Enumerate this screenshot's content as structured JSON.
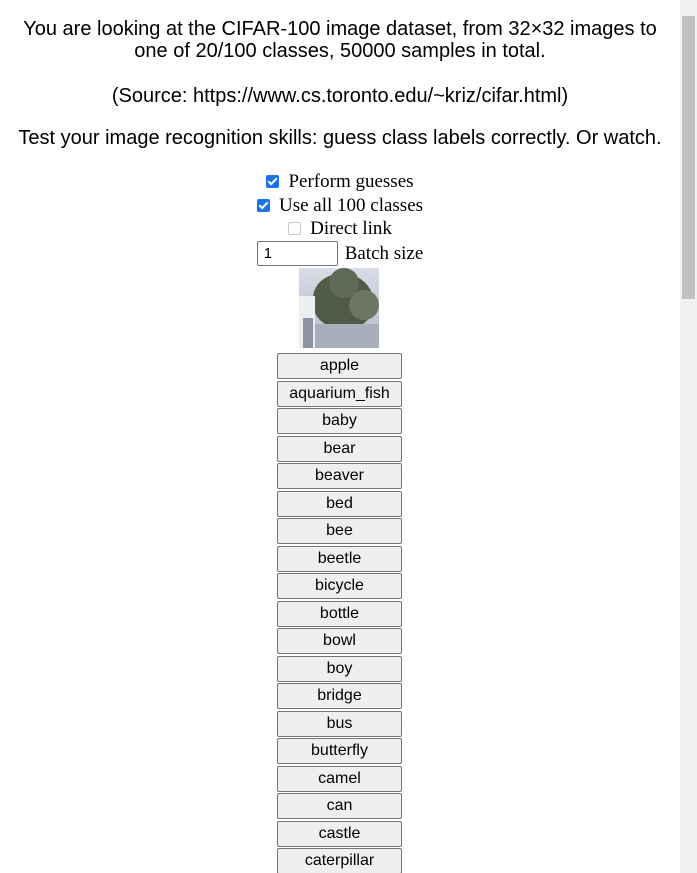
{
  "intro": {
    "line1": "You are looking at the CIFAR-100 image dataset, from 32×32 images to one of 20/100 classes, 50000 samples in total.",
    "line2": "(Source: https://www.cs.toronto.edu/~kriz/cifar.html)",
    "line3": "Test your image recognition skills: guess class labels correctly. Or watch."
  },
  "options": {
    "perform_guesses": {
      "label": "Perform guesses",
      "checked": true
    },
    "use_all_classes": {
      "label": "Use all 100 classes",
      "checked": true
    },
    "direct_link": {
      "label": "Direct link",
      "checked": false
    },
    "batch_size": {
      "label": "Batch size",
      "value": "1"
    }
  },
  "classes": [
    "apple",
    "aquarium_fish",
    "baby",
    "bear",
    "beaver",
    "bed",
    "bee",
    "beetle",
    "bicycle",
    "bottle",
    "bowl",
    "boy",
    "bridge",
    "bus",
    "butterfly",
    "camel",
    "can",
    "castle",
    "caterpillar"
  ],
  "colors": {
    "checkbox_accent": "#1a73e8",
    "button_bg": "#efefef",
    "button_border": "#767676"
  }
}
